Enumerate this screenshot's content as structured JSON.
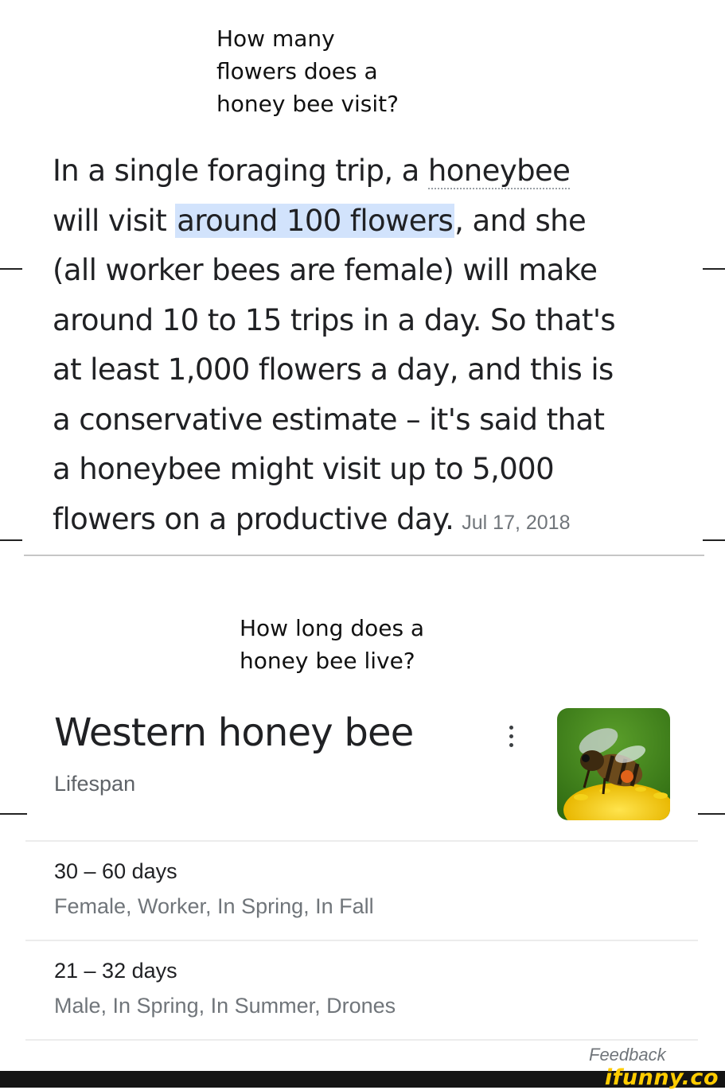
{
  "question1": {
    "lines": [
      "How many",
      "flowers does a",
      "honey bee visit?"
    ]
  },
  "snippet": {
    "l1_a": "In a single foraging trip, a ",
    "l1_link": "honeybee",
    "l2_a": "will visit ",
    "l2_hl": "around 100 flowers",
    "l2_b": ", and she",
    "l3": "(all worker bees are female) will make",
    "l4": "around 10 to 15 trips in a day. So that's",
    "l5": "at least 1,000 flowers a day, and this is",
    "l6": "a conservative estimate – it's said that",
    "l7": "a honeybee might visit up to 5,000",
    "l8": "flowers on a productive day.",
    "date": "Jul 17, 2018"
  },
  "question2": {
    "lines": [
      "How long does a",
      "honey bee live?"
    ]
  },
  "knowledge_panel": {
    "title": "Western honey bee",
    "subtitle": "Lifespan",
    "image_icon": "bee-on-flower-image",
    "rows": [
      {
        "days": "30 – 60 days",
        "detail": "Female, Worker, In Spring, In Fall"
      },
      {
        "days": "21 – 32 days",
        "detail": "Male, In Spring, In Summer, Drones"
      }
    ],
    "feedback": "Feedback"
  },
  "watermark": "ifunny.co",
  "colors": {
    "highlight": "#d2e3fc",
    "watermark": "#ffcc00"
  }
}
